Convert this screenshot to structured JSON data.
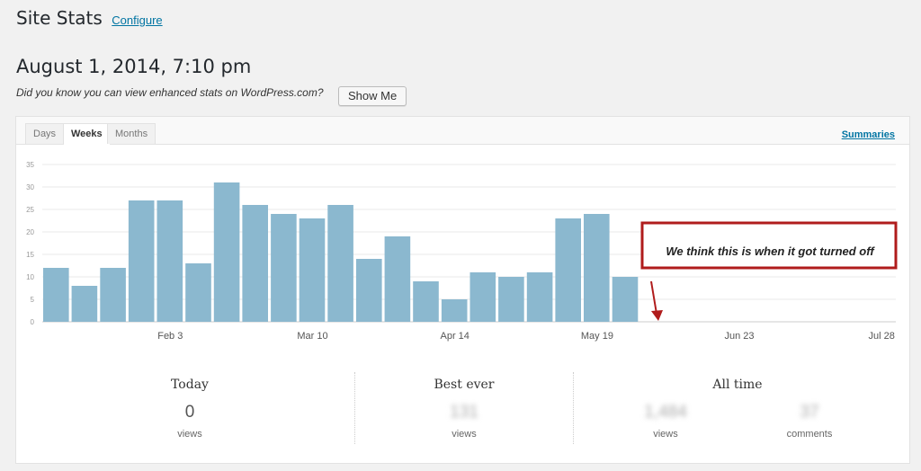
{
  "header": {
    "title": "Site Stats",
    "configure_link": "Configure"
  },
  "date": "August 1, 2014, 7:10 pm",
  "promo": {
    "text": "Did you know you can view enhanced stats on WordPress.com?",
    "button": "Show Me"
  },
  "tabs": [
    {
      "label": "Days",
      "active": false
    },
    {
      "label": "Weeks",
      "active": true
    },
    {
      "label": "Months",
      "active": false
    }
  ],
  "summaries_link": "Summaries",
  "annotation": "We think this is when it got turned off",
  "chart_data": {
    "type": "bar",
    "values": [
      12,
      8,
      12,
      27,
      27,
      13,
      31,
      26,
      24,
      23,
      26,
      14,
      19,
      9,
      5,
      11,
      10,
      11,
      23,
      24,
      10,
      0,
      0,
      0,
      0,
      0,
      0,
      0,
      0,
      0
    ],
    "x_tick_labels": [
      "Feb 3",
      "Mar 10",
      "Apr 14",
      "May 19",
      "Jun 23",
      "Jul 28"
    ],
    "y_tick_labels": [
      "35",
      "30",
      "25",
      "20",
      "15",
      "10",
      "5",
      "0"
    ],
    "ylim": [
      0,
      35
    ],
    "grid": true,
    "bar_color": "#8bb8cf"
  },
  "stats": {
    "today": {
      "title": "Today",
      "value": "0",
      "unit": "views"
    },
    "best": {
      "title": "Best ever",
      "value": "131",
      "unit": "views"
    },
    "all_time": {
      "title": "All time",
      "views": "1,484",
      "views_unit": "views",
      "comments": "37",
      "comments_unit": "comments"
    }
  },
  "colors": {
    "link": "#0074a2",
    "bar": "#8bb8cf",
    "annotation_border": "#b01c1c"
  }
}
